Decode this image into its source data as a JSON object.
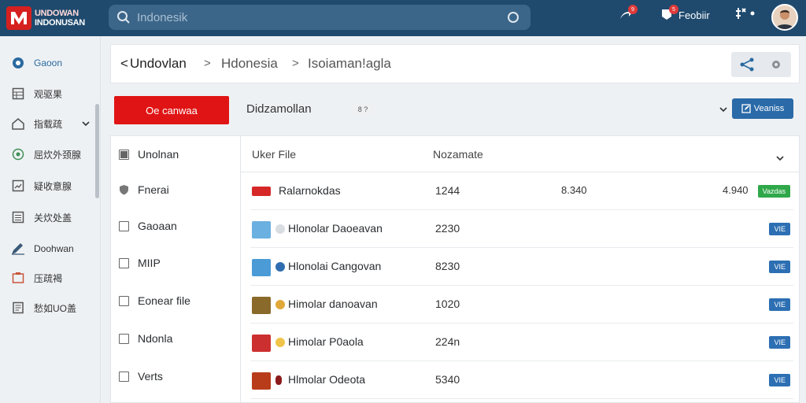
{
  "app": {
    "logo_line1": "UNDOWAN",
    "logo_line2": "INDONUSAN"
  },
  "search": {
    "placeholder": "Indonesik"
  },
  "top_actions": {
    "badge1": "9",
    "badge2": "5",
    "profile_label": "Feobiir"
  },
  "sidebar": {
    "items": [
      {
        "label": "Gaoon",
        "icon": "circle-icon",
        "active": true
      },
      {
        "label": "观驱果",
        "icon": "grid-icon"
      },
      {
        "label": "指载疏",
        "icon": "home-icon"
      },
      {
        "label": "屈炊外颈腺",
        "icon": "shield-icon"
      },
      {
        "label": "疑收意腺",
        "icon": "chart-icon"
      },
      {
        "label": "关炊处盖",
        "icon": "table-icon"
      },
      {
        "label": "Doohwan",
        "icon": "pen-icon"
      },
      {
        "label": "压疏褐",
        "icon": "image-icon"
      },
      {
        "label": "愁如UO盖",
        "icon": "doc-icon"
      }
    ]
  },
  "breadcrumb": {
    "back": "<",
    "items": [
      "Undovlan",
      "Hdonesia",
      "Isoiaman!agla"
    ],
    "sep": ">"
  },
  "toolbar": {
    "primary_button": "Oe canwaa",
    "label": "Didzamollan",
    "pill": "8 ?",
    "view_button": "Veaniss"
  },
  "filters": [
    {
      "label": "Unolnan",
      "checked": true,
      "icon": "checkbox"
    },
    {
      "label": "Fnerai",
      "checked": false,
      "icon": "shield"
    },
    {
      "label": "Gaoaan",
      "checked": false,
      "icon": "checkbox"
    },
    {
      "label": "MIIP",
      "checked": false,
      "icon": "checkbox"
    },
    {
      "label": "Eonear file",
      "checked": false,
      "icon": "checkbox"
    },
    {
      "label": "Ndonla",
      "checked": false,
      "icon": "checkbox"
    },
    {
      "label": "Verts",
      "checked": false,
      "icon": "checkbox"
    }
  ],
  "table": {
    "headers": [
      "Uker File",
      "Nozamate"
    ],
    "rows": [
      {
        "name": "Ralarnokdas",
        "size": "1244",
        "s2": "8.340",
        "s3": "4.940",
        "tag": "Vazdas",
        "tag_color": "#2fa84a",
        "thumb": "#d22"
      },
      {
        "name": "Hlonolar Daoeavan",
        "size": "2230",
        "tag": "VIE",
        "tag_color": "#2d6fb3",
        "thumb": "#6ab0e0"
      },
      {
        "name": "Hlonolai Cangovan",
        "size": "8230",
        "tag": "VIE",
        "tag_color": "#2d6fb3",
        "thumb": "#4a9bd6"
      },
      {
        "name": "Himolar danoavan",
        "size": "1020",
        "tag": "VIE",
        "tag_color": "#2d6fb3",
        "thumb": "#8a6a2a"
      },
      {
        "name": "Himolar P0aola",
        "size": "224n",
        "tag": "VIE",
        "tag_color": "#2d6fb3",
        "thumb": "#cc2f2f"
      },
      {
        "name": "Hlmolar Odeota",
        "size": "5340",
        "tag": "VIE",
        "tag_color": "#2d6fb3",
        "thumb": "#b83c1a"
      }
    ]
  }
}
